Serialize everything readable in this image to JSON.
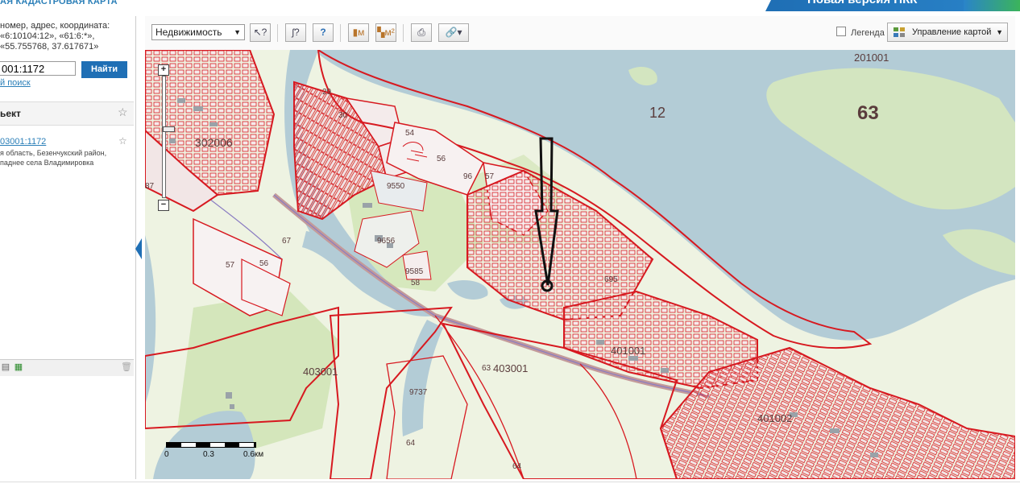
{
  "header": {
    "title": "АЯ КАДАСТРОВАЯ КАРТА",
    "new_version": "Новая версия ПКК"
  },
  "search": {
    "hint": "номер, адрес, координата: «6:10104:12», «61:6:*», «55.755768, 37.617671»",
    "value": "001:1172",
    "button": "Найти",
    "advanced": "й поиск"
  },
  "object_panel": {
    "title": "ьект",
    "item_number": "03001:1172",
    "item_description": "я область, Безенчукский район, паднее села Владимировка"
  },
  "toolbar": {
    "layer_select": "Недвижимость",
    "legend": "Легенда",
    "map_control": "Управление картой",
    "icons": [
      "select-info-icon",
      "measure-curve-icon",
      "info-query-icon",
      "ruler-length-icon",
      "ruler-area-icon",
      "print-icon",
      "link-icon"
    ]
  },
  "map": {
    "labels": {
      "q201001": "201001",
      "n63": "63",
      "n12": "12",
      "q302006": "302006",
      "n87": "87",
      "n29": "29",
      "n30": "30",
      "n54": "54",
      "n56a": "56",
      "n56b": "56",
      "n57a": "57",
      "n57b": "57",
      "n9550": "9550",
      "n9656": "9656",
      "n9585": "9585",
      "n58": "58",
      "n67": "67",
      "n695": "695",
      "q401001": "401001",
      "q403001a": "403001",
      "q403001b": "403001",
      "n63b": "63",
      "n9737": "9737",
      "n64a": "64",
      "n64b": "64",
      "q401002": "401002",
      "n96": "96"
    },
    "zoom": {
      "in": "+",
      "out": "−"
    },
    "scale": {
      "l0": "0",
      "l1": "0.3",
      "l2": "0.6км"
    },
    "colors": {
      "water": "#b3ccd6",
      "land": "#e9f0dc",
      "forest": "#cfe3b3",
      "parcel": "#d71920",
      "road": "#c9a9a9"
    }
  }
}
